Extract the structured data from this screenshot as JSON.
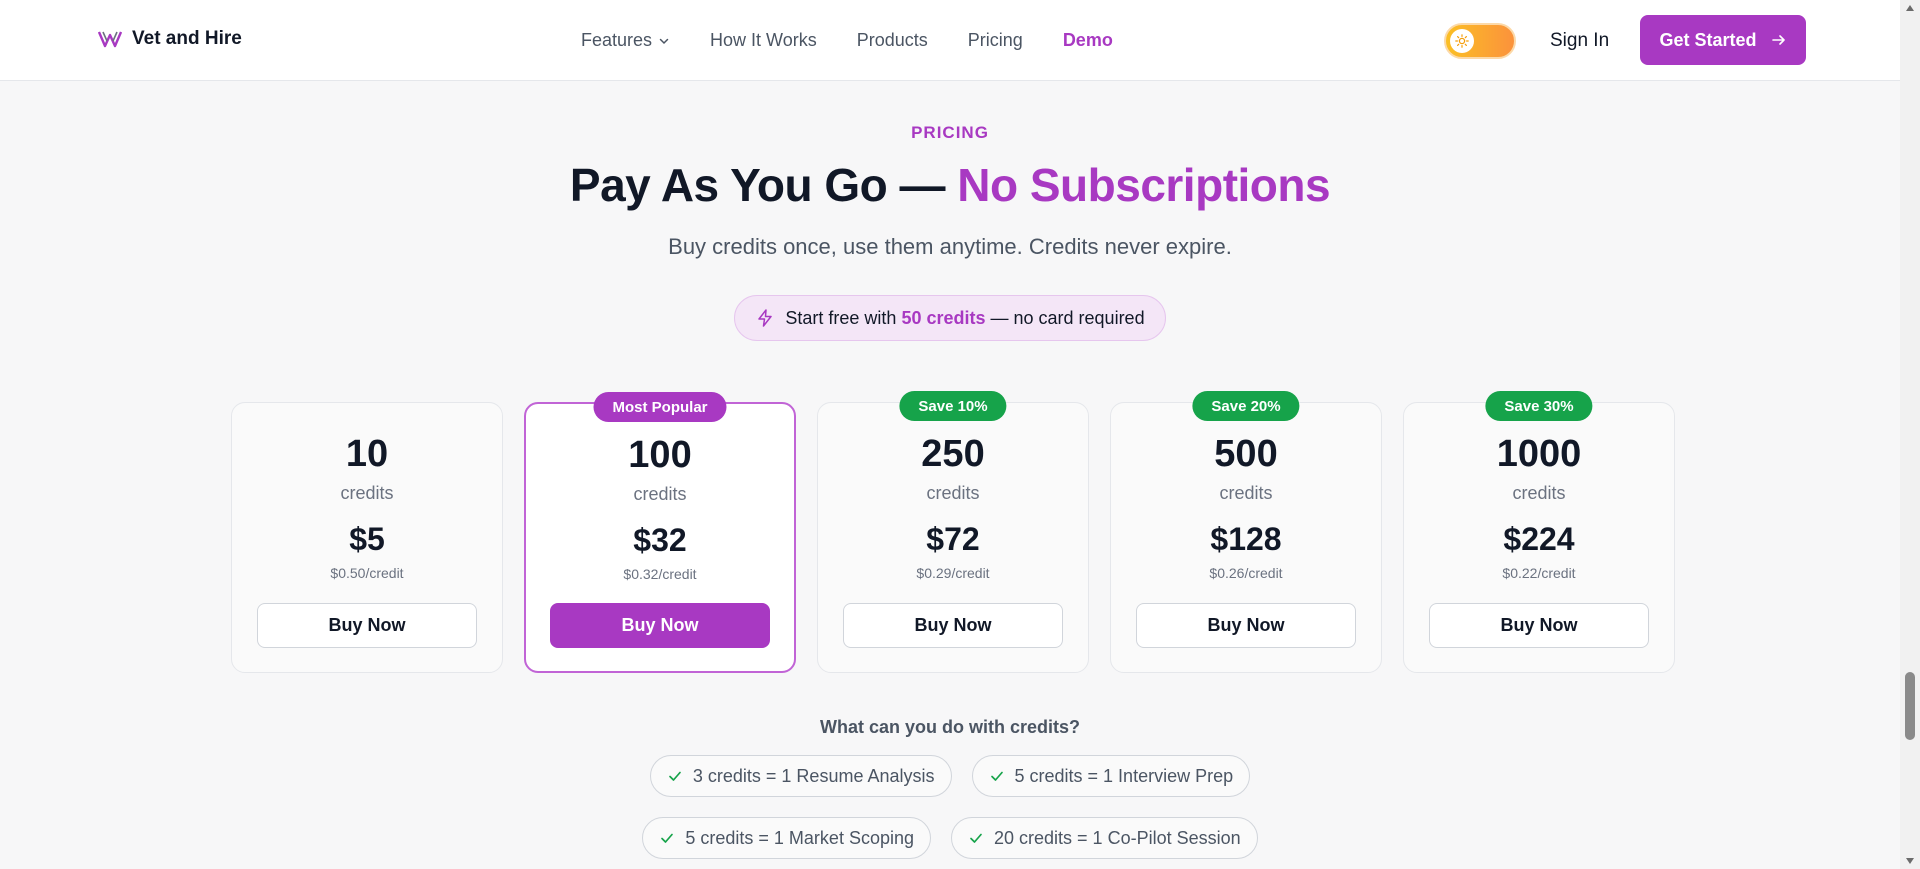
{
  "header": {
    "brand": "Vet and Hire",
    "nav": [
      {
        "label": "Features",
        "has_dropdown": true,
        "active": false
      },
      {
        "label": "How It Works",
        "active": false
      },
      {
        "label": "Products",
        "active": false
      },
      {
        "label": "Pricing",
        "active": false
      },
      {
        "label": "Demo",
        "active": true
      }
    ],
    "theme_toggle": "light",
    "sign_in": "Sign In",
    "get_started": "Get Started"
  },
  "pricing": {
    "eyebrow": "PRICING",
    "headline_main": "Pay As You Go — ",
    "headline_accent": "No Subscriptions",
    "subhead": "Buy credits once, use them anytime. Credits never expire.",
    "free_pill": {
      "prefix": "Start free with ",
      "highlight": "50 credits",
      "suffix": " — no card required"
    },
    "plans": [
      {
        "amount": "10",
        "unit": "credits",
        "price": "$5",
        "per": "$0.50/credit",
        "button": "Buy Now",
        "badge": ""
      },
      {
        "amount": "100",
        "unit": "credits",
        "price": "$32",
        "per": "$0.32/credit",
        "button": "Buy Now",
        "badge": "Most Popular"
      },
      {
        "amount": "250",
        "unit": "credits",
        "price": "$72",
        "per": "$0.29/credit",
        "button": "Buy Now",
        "badge": "Save 10%"
      },
      {
        "amount": "500",
        "unit": "credits",
        "price": "$128",
        "per": "$0.26/credit",
        "button": "Buy Now",
        "badge": "Save 20%"
      },
      {
        "amount": "1000",
        "unit": "credits",
        "price": "$224",
        "per": "$0.22/credit",
        "button": "Buy Now",
        "badge": "Save 30%"
      }
    ],
    "uses_title": "What can you do with credits?",
    "uses": [
      "3 credits = 1 Resume Analysis",
      "5 credits = 1 Interview Prep",
      "5 credits = 1 Market Scoping",
      "20 credits = 1 Co-Pilot Session"
    ]
  },
  "colors": {
    "accent": "#a839c2",
    "badge_green": "#16a34a",
    "pill_bg": "#f4e6f7",
    "page_bg": "#f7f7f8"
  },
  "icons": {
    "logo": "vh-logo-icon",
    "features_chevron": "chevron-down-icon",
    "theme": "sun-icon",
    "cta": "arrow-right-icon",
    "pill": "lightning-bolt-icon",
    "use_item": "check-icon"
  }
}
